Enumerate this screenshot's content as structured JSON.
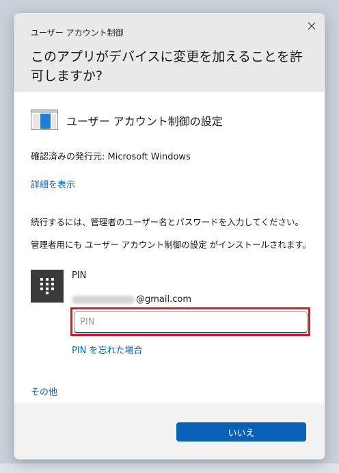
{
  "window": {
    "title": "ユーザー アカウント制御",
    "close_icon": "close-icon"
  },
  "prompt": {
    "question": "このアプリがデバイスに変更を加えることを許可しますか?"
  },
  "app": {
    "icon": "window-app-icon",
    "name": "ユーザー アカウント制御の設定",
    "publisher": "確認済みの発行元: Microsoft Windows",
    "details_link": "詳細を表示"
  },
  "instructions": {
    "line1": "続行するには、管理者のユーザー名とパスワードを入力してください。",
    "line2": "管理者用にも ユーザー アカウント制御の設定 がインストールされます。"
  },
  "credential": {
    "icon": "pin-keypad-icon",
    "label": "PIN",
    "email_domain": "@gmail.com",
    "pin_placeholder": "PIN",
    "pin_value": "",
    "forgot_pin_link": "PIN を忘れた場合"
  },
  "more_choices": "その他",
  "buttons": {
    "no_label": "いいえ"
  },
  "colors": {
    "accent": "#0a62b8",
    "highlight": "#e3161f",
    "header_bg": "#e9e9e9",
    "footer_bg": "#f2f2f2"
  }
}
